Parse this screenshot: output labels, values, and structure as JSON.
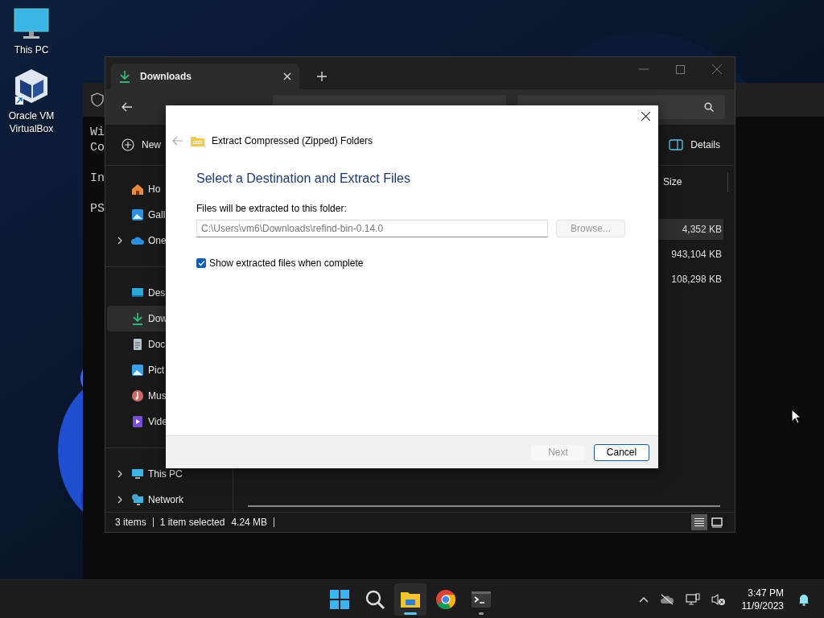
{
  "desktop_icons": [
    {
      "kind": "monitor",
      "label": "This PC"
    },
    {
      "kind": "cube",
      "label": "Oracle VM VirtualBox"
    }
  ],
  "terminal": {
    "line_groups": [
      [
        "Wi",
        "Co"
      ],
      [
        "In"
      ],
      [
        "PS"
      ]
    ]
  },
  "explorer": {
    "tabs": [
      {
        "label": "Downloads",
        "selected": true
      }
    ],
    "command_bar": {
      "new": "New",
      "details": "Details"
    },
    "sidebar": [
      [
        {
          "kind": "home",
          "label": "Ho",
          "selected": false,
          "has_children": false
        },
        {
          "kind": "gallery",
          "label": "Gall",
          "selected": false,
          "has_children": false
        },
        {
          "kind": "cloud",
          "label": "One",
          "selected": false,
          "has_children": true
        }
      ],
      [
        {
          "kind": "desktop",
          "label": "Des",
          "selected": false,
          "has_children": false
        },
        {
          "kind": "download",
          "label": "Dow",
          "selected": true,
          "has_children": false
        },
        {
          "kind": "document",
          "label": "Doc",
          "selected": false,
          "has_children": false
        },
        {
          "kind": "pictures",
          "label": "Pict",
          "selected": false,
          "has_children": false
        },
        {
          "kind": "music",
          "label": "Mus",
          "selected": false,
          "has_children": false
        },
        {
          "kind": "videos",
          "label": "Vide",
          "selected": false,
          "has_children": false
        }
      ],
      [
        {
          "kind": "monitor",
          "label": "This PC",
          "selected": false,
          "has_children": true
        },
        {
          "kind": "network",
          "label": "Network",
          "selected": false,
          "has_children": true
        }
      ]
    ],
    "columns": [
      {
        "label": "Size"
      }
    ],
    "rows": [
      {
        "size": "4,352 KB",
        "selected": true
      },
      {
        "size": "943,104 KB",
        "selected": false
      },
      {
        "size": "108,298 KB",
        "selected": false
      }
    ],
    "status_bar": {
      "count": "3 items",
      "selection": "1 item selected",
      "size": "4.24 MB"
    },
    "views": [
      {
        "kind": "details",
        "selected": true
      },
      {
        "kind": "tiles",
        "selected": false
      }
    ]
  },
  "dialog": {
    "title": "Extract Compressed (Zipped) Folders",
    "heading": "Select a Destination and Extract Files",
    "field_label": "Files will be extracted to this folder:",
    "path": "C:\\Users\\vm6\\Downloads\\refind-bin-0.14.0",
    "browse": {
      "label": "Browse...",
      "disabled": true
    },
    "show_files": {
      "label": "Show extracted files when complete",
      "checked": true
    },
    "buttons": [
      {
        "label": "Next",
        "disabled": true
      },
      {
        "label": "Cancel",
        "disabled": false
      }
    ]
  },
  "taskbar": {
    "apps": [
      {
        "kind": "start",
        "active": false,
        "running": false
      },
      {
        "kind": "search",
        "active": false,
        "running": false
      },
      {
        "kind": "explorer",
        "active": true,
        "running": true
      },
      {
        "kind": "chrome",
        "active": false,
        "running": false
      },
      {
        "kind": "terminal",
        "active": false,
        "running": true
      }
    ],
    "time": "3:47 PM",
    "date": "11/9/2023"
  }
}
